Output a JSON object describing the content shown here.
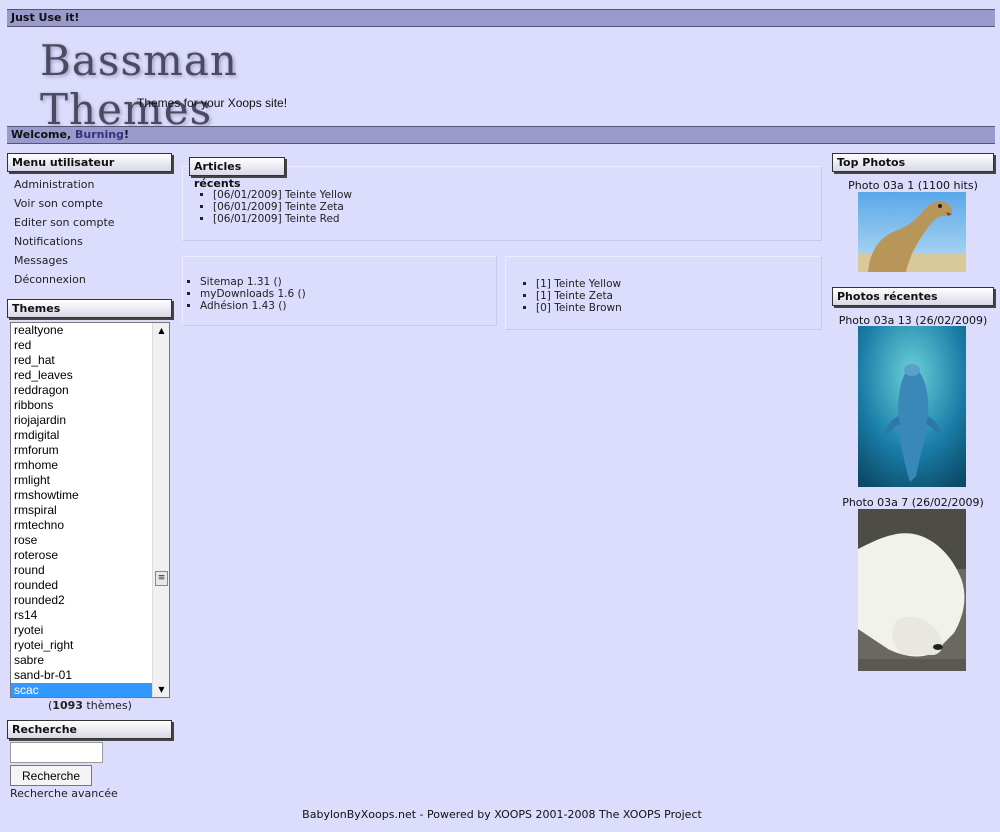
{
  "top_bar": {
    "label": "Just Use it!"
  },
  "logo": {
    "title": "Bassman Themes",
    "subtitle": "Themes for your Xoops site!"
  },
  "welcome_bar": {
    "prefix": "Welcome, ",
    "user": "Burning",
    "suffix": "!"
  },
  "user_menu": {
    "title": "Menu utilisateur",
    "items": [
      {
        "label": "Administration"
      },
      {
        "label": "Voir son compte"
      },
      {
        "label": "Editer son compte"
      },
      {
        "label": "Notifications"
      },
      {
        "label": "Messages"
      },
      {
        "label": "Déconnexion"
      }
    ]
  },
  "themes": {
    "title": "Themes",
    "options": [
      "realtyone",
      "red",
      "red_hat",
      "red_leaves",
      "reddragon",
      "ribbons",
      "riojajardin",
      "rmdigital",
      "rmforum",
      "rmhome",
      "rmlight",
      "rmshowtime",
      "rmspiral",
      "rmtechno",
      "rose",
      "roterose",
      "round",
      "rounded",
      "rounded2",
      "rs14",
      "ryotei",
      "ryotei_right",
      "sabre",
      "sand-br-01",
      "scac"
    ],
    "selected": "scac",
    "count_open": "(",
    "count": "1093",
    "count_suffix": " thèmes)"
  },
  "search": {
    "title": "Recherche",
    "input_value": "",
    "button_label": "Recherche",
    "advanced_label": "Recherche avancée"
  },
  "recent_articles": {
    "title": "Articles récents",
    "items": [
      {
        "label": "[06/01/2009] Teinte Yellow"
      },
      {
        "label": "[06/01/2009] Teinte Zeta"
      },
      {
        "label": "[06/01/2009] Teinte Red"
      }
    ]
  },
  "modules_list": {
    "items": [
      {
        "label": "Sitemap 1.31 ()"
      },
      {
        "label": "myDownloads 1.6 ()"
      },
      {
        "label": "Adhésion 1.43 ()"
      }
    ]
  },
  "counts_list": {
    "items": [
      {
        "label": "[1] Teinte Yellow"
      },
      {
        "label": "[1] Teinte Zeta"
      },
      {
        "label": "[0] Teinte Brown"
      }
    ]
  },
  "top_photos": {
    "title": "Top Photos",
    "items": [
      {
        "caption": "Photo 03a 1 (1100 hits)",
        "icon": "camel-photo"
      }
    ]
  },
  "recent_photos": {
    "title": "Photos récentes",
    "items": [
      {
        "caption": "Photo 03a 13 (26/02/2009)",
        "icon": "dolphin-photo"
      },
      {
        "caption": "Photo 03a 7 (26/02/2009)",
        "icon": "polar-bear-photo"
      }
    ]
  },
  "footer": {
    "text": "BabylonByXoops.net - Powered by XOOPS 2001-2008 The XOOPS Project"
  },
  "colors": {
    "background": "#dcdcfc",
    "bar": "#9999cc",
    "selected": "#3399ff"
  }
}
